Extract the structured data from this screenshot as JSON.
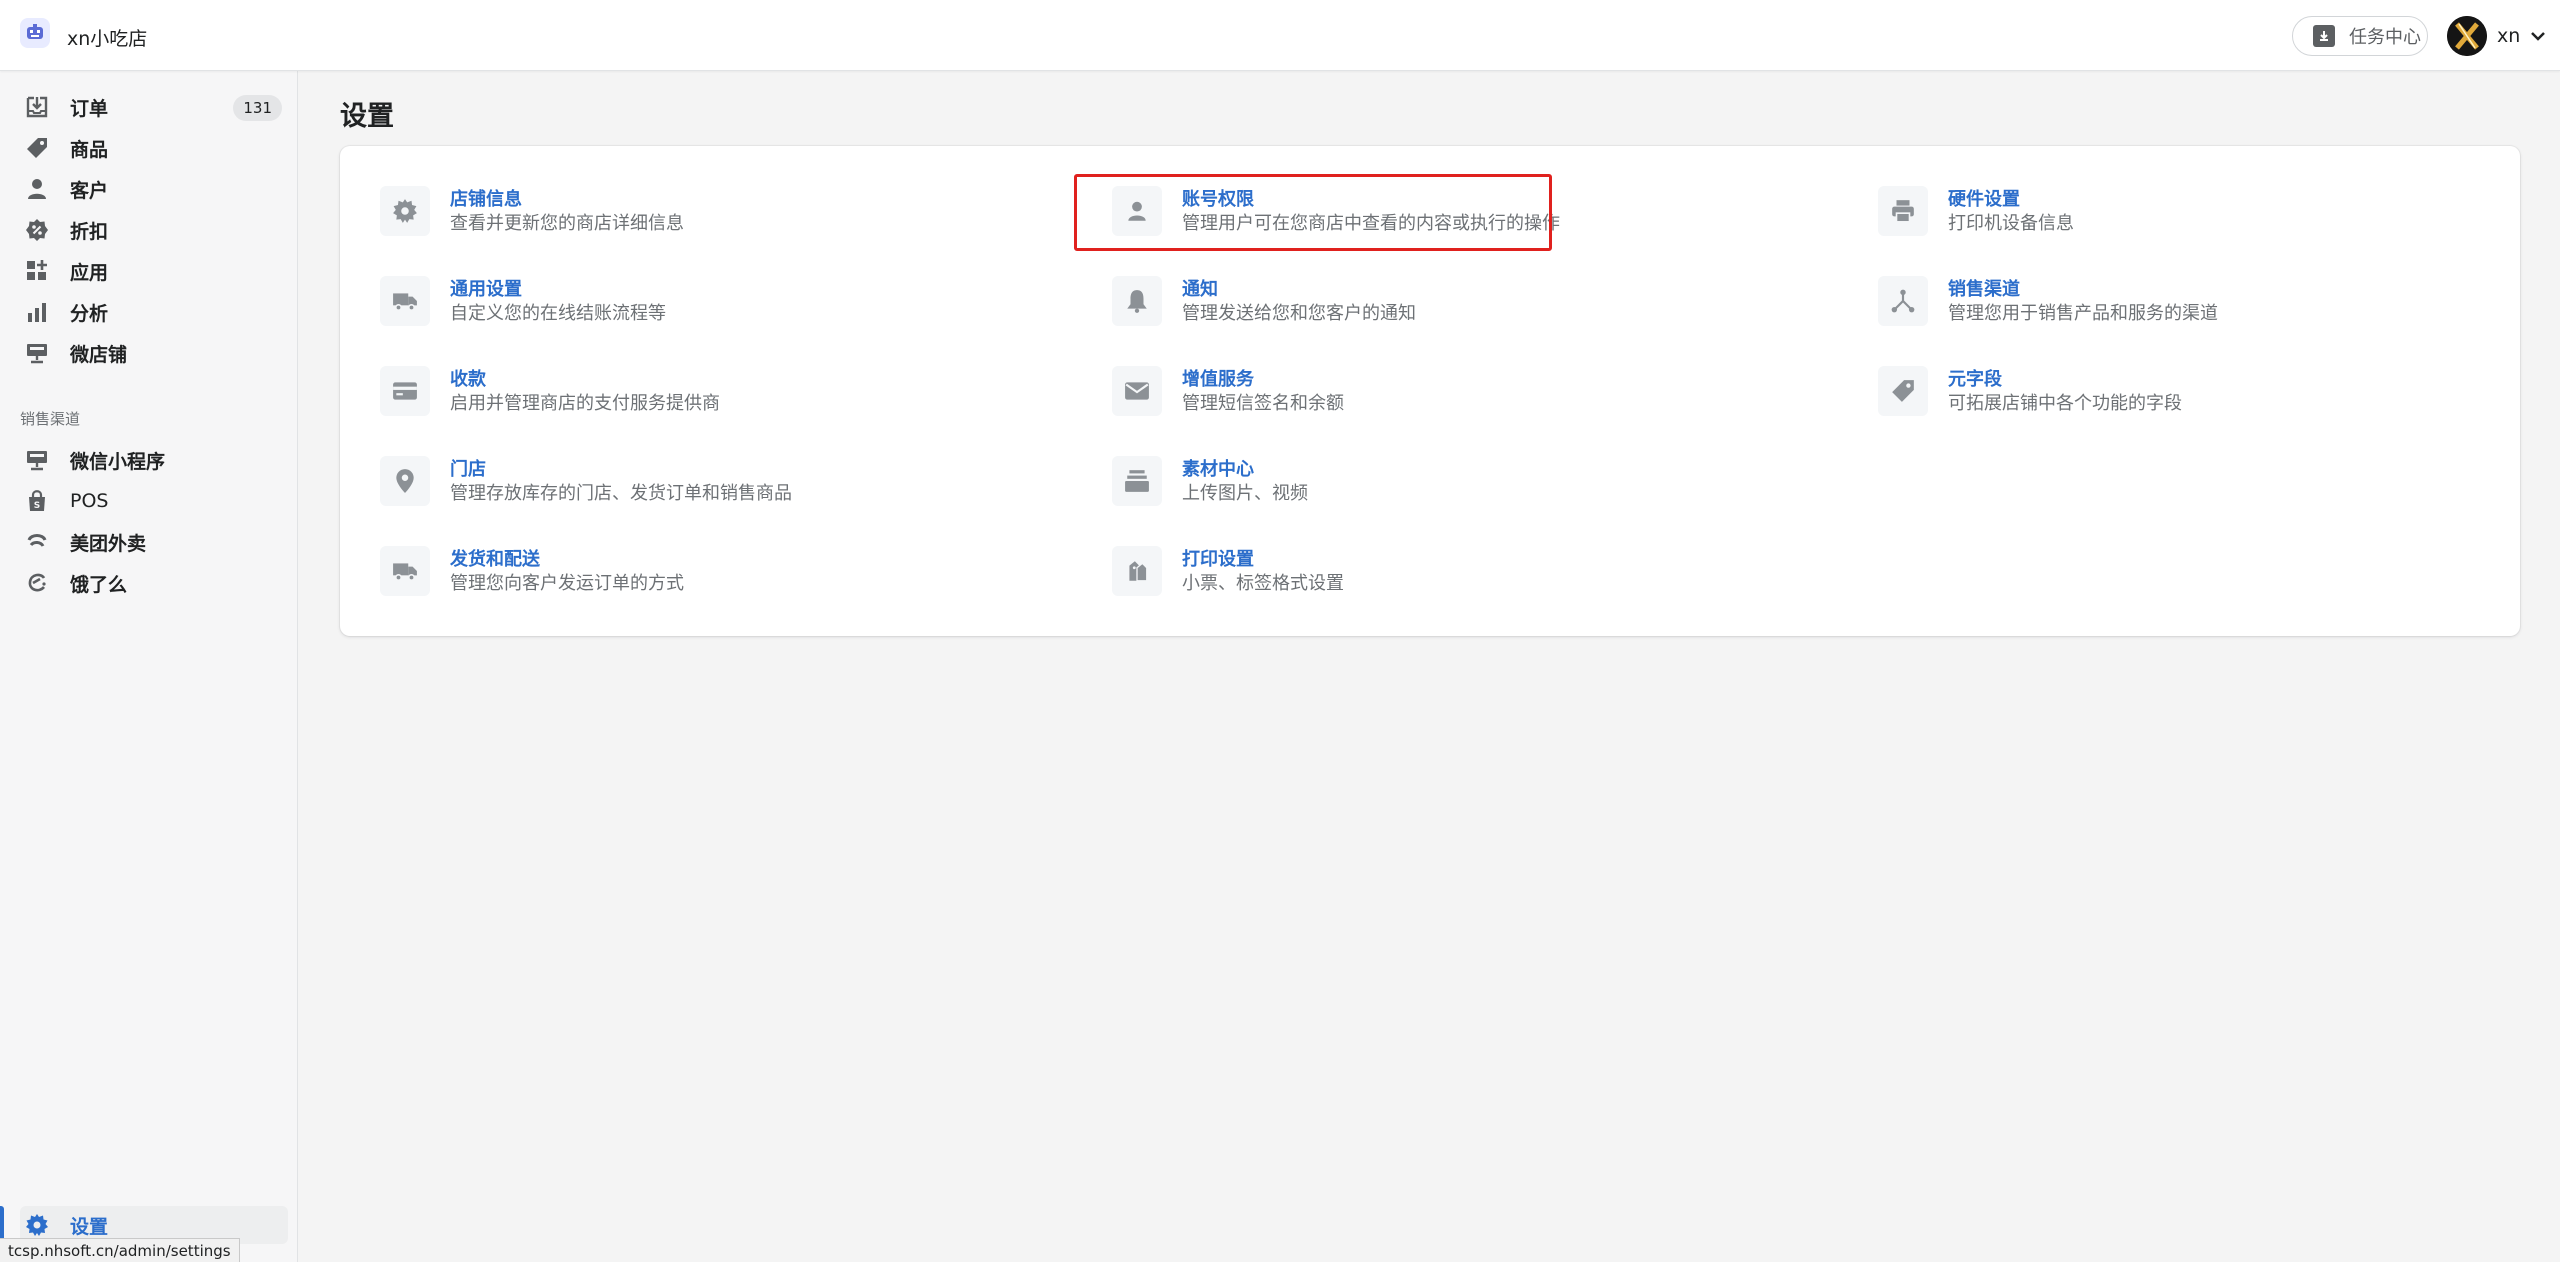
{
  "header": {
    "store_name": "xn小吃店",
    "task_center_label": "任务中心",
    "user_name": "xn"
  },
  "sidebar": {
    "items": [
      {
        "label": "订单",
        "icon": "order-download-icon",
        "badge": "131"
      },
      {
        "label": "商品",
        "icon": "tag-icon"
      },
      {
        "label": "客户",
        "icon": "person-icon"
      },
      {
        "label": "折扣",
        "icon": "discount-icon"
      },
      {
        "label": "应用",
        "icon": "apps-icon"
      },
      {
        "label": "分析",
        "icon": "bar-chart-icon"
      },
      {
        "label": "微店铺",
        "icon": "storefront-icon"
      }
    ],
    "channels_label": "销售渠道",
    "channels": [
      {
        "label": "微信小程序",
        "icon": "storefront-icon"
      },
      {
        "label": "POS",
        "icon": "shopping-bag-icon"
      },
      {
        "label": "美团外卖",
        "icon": "meituan-icon"
      },
      {
        "label": "饿了么",
        "icon": "eleme-icon"
      }
    ],
    "settings_label": "设置"
  },
  "status_bar": {
    "url": "tcsp.nhsoft.cn/admin/settings"
  },
  "main": {
    "title": "设置",
    "settings": [
      {
        "title": "店铺信息",
        "desc": "查看并更新您的商店详细信息",
        "icon": "gear-icon"
      },
      {
        "title": "账号权限",
        "desc": "管理用户可在您商店中查看的内容或执行的操作",
        "icon": "person-icon"
      },
      {
        "title": "硬件设置",
        "desc": "打印机设备信息",
        "icon": "printer-icon"
      },
      {
        "title": "通用设置",
        "desc": "自定义您的在线结账流程等",
        "icon": "truck-icon"
      },
      {
        "title": "通知",
        "desc": "管理发送给您和您客户的通知",
        "icon": "bell-icon"
      },
      {
        "title": "销售渠道",
        "desc": "管理您用于销售产品和服务的渠道",
        "icon": "channels-icon"
      },
      {
        "title": "收款",
        "desc": "启用并管理商店的支付服务提供商",
        "icon": "credit-card-icon"
      },
      {
        "title": "增值服务",
        "desc": "管理短信签名和余额",
        "icon": "mail-icon"
      },
      {
        "title": "元字段",
        "desc": "可拓展店铺中各个功能的字段",
        "icon": "tag-icon"
      },
      {
        "title": "门店",
        "desc": "管理存放库存的门店、发货订单和销售商品",
        "icon": "location-pin-icon"
      },
      {
        "title": "素材中心",
        "desc": "上传图片、视频",
        "icon": "archive-icon"
      },
      {
        "title": "发货和配送",
        "desc": "管理您向客户发运订单的方式",
        "icon": "truck-icon"
      },
      {
        "title": "打印设置",
        "desc": "小票、标签格式设置",
        "icon": "tags-print-icon"
      }
    ]
  },
  "colors": {
    "accent": "#2c6ecb",
    "highlight_border": "#e0211e"
  }
}
